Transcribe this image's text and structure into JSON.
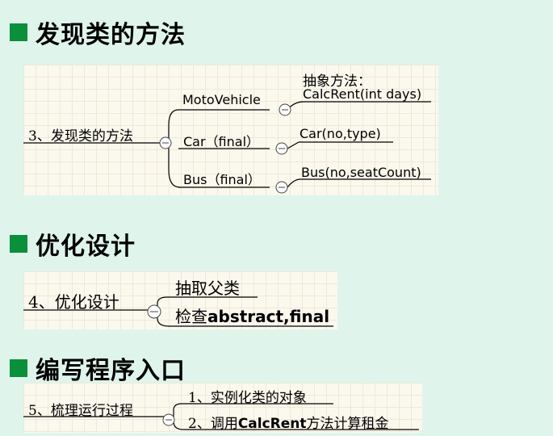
{
  "sections": [
    {
      "heading": "发现类的方法",
      "root": "3、发现类的方法",
      "children": [
        {
          "label": "MotoVehicle",
          "leaf_line1": "抽象方法：",
          "leaf_line2": "CalcRent(int days)"
        },
        {
          "label": "Car（final）",
          "leaf": "Car(no,type)"
        },
        {
          "label": "Bus（final）",
          "leaf": "Bus(no,seatCount)"
        }
      ]
    },
    {
      "heading": "优化设计",
      "root": "4、优化设计",
      "children": [
        {
          "label": "抽取父类"
        },
        {
          "label_prefix": "检查",
          "label_suffix": "abstract,final"
        }
      ]
    },
    {
      "heading": "编写程序入口",
      "root": "5、梳理运行过程",
      "children": [
        {
          "label": "1、实例化类的对象"
        },
        {
          "label_prefix": "2、调用",
          "label_mid": "CalcRent",
          "label_suffix": "方法计算租金"
        }
      ]
    }
  ],
  "colors": {
    "accent": "#0a8f3a",
    "background": "#dff5ec",
    "panel": "#fbf8ee"
  },
  "icons": {
    "collapse": "minus-circle-icon",
    "bullet": "square-bullet-icon"
  }
}
